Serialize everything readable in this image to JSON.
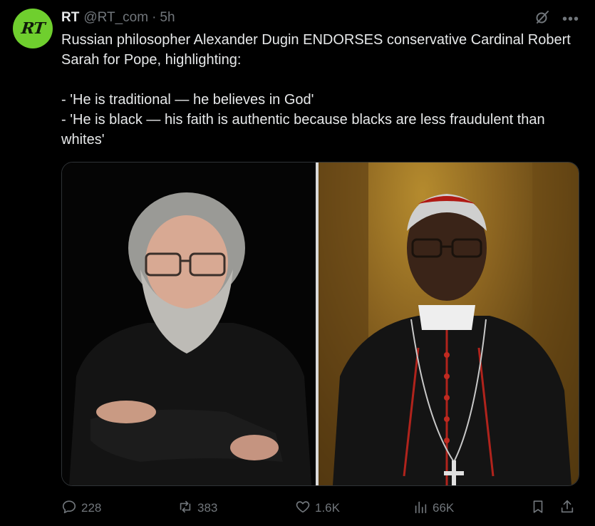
{
  "account": {
    "avatar_text": "RT",
    "name": "RT",
    "handle": "@RT_com",
    "separator": "·",
    "time": "5h"
  },
  "post": {
    "text": "Russian philosopher Alexander Dugin ENDORSES conservative Cardinal Robert Sarah for Pope, highlighting:\n\n- 'He is traditional — he believes in God'\n- 'He is black — his faith is authentic because blacks are less fraudulent than whites'"
  },
  "icons": {
    "grok": "grok-icon",
    "more": "more-icon",
    "reply": "reply-icon",
    "repost": "repost-icon",
    "like": "heart-icon",
    "views": "views-icon",
    "bookmark": "bookmark-icon",
    "share": "share-icon"
  },
  "actions": {
    "replies": "228",
    "reposts": "383",
    "likes": "1.6K",
    "views": "66K"
  },
  "colors": {
    "background": "#000000",
    "text": "#e7e9ea",
    "muted": "#71767b",
    "avatar": "#6fcf2e"
  }
}
